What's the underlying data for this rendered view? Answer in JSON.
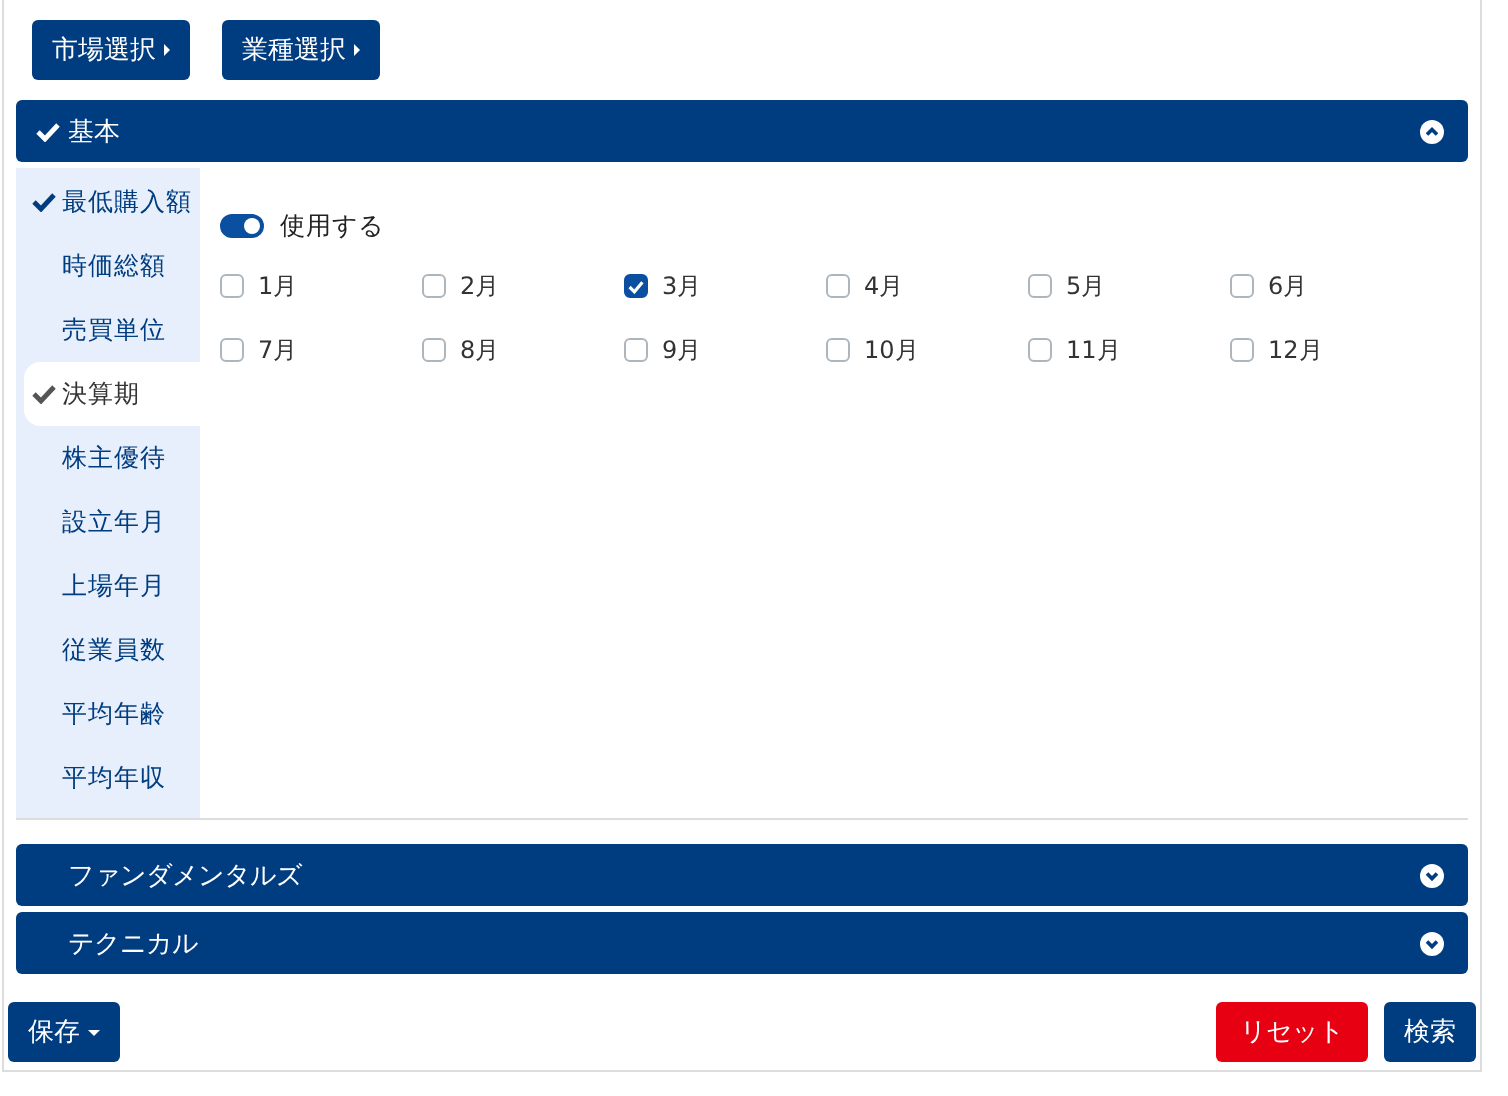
{
  "top_buttons": [
    {
      "label": "市場選択"
    },
    {
      "label": "業種選択"
    }
  ],
  "sections": [
    {
      "title": "基本",
      "checked": true,
      "expanded": true,
      "sidebar": [
        {
          "label": "最低購入額",
          "checked": true,
          "selected": false
        },
        {
          "label": "時価総額",
          "checked": false,
          "selected": false
        },
        {
          "label": "売買単位",
          "checked": false,
          "selected": false
        },
        {
          "label": "決算期",
          "checked": true,
          "selected": true
        },
        {
          "label": "株主優待",
          "checked": false,
          "selected": false
        },
        {
          "label": "設立年月",
          "checked": false,
          "selected": false
        },
        {
          "label": "上場年月",
          "checked": false,
          "selected": false
        },
        {
          "label": "従業員数",
          "checked": false,
          "selected": false
        },
        {
          "label": "平均年齢",
          "checked": false,
          "selected": false
        },
        {
          "label": "平均年収",
          "checked": false,
          "selected": false
        }
      ],
      "toggle": {
        "label": "使用する",
        "on": true
      },
      "months": [
        {
          "label": "1月",
          "checked": false
        },
        {
          "label": "2月",
          "checked": false
        },
        {
          "label": "3月",
          "checked": true
        },
        {
          "label": "4月",
          "checked": false
        },
        {
          "label": "5月",
          "checked": false
        },
        {
          "label": "6月",
          "checked": false
        },
        {
          "label": "7月",
          "checked": false
        },
        {
          "label": "8月",
          "checked": false
        },
        {
          "label": "9月",
          "checked": false
        },
        {
          "label": "10月",
          "checked": false
        },
        {
          "label": "11月",
          "checked": false
        },
        {
          "label": "12月",
          "checked": false
        }
      ]
    },
    {
      "title": "ファンダメンタルズ",
      "checked": false,
      "expanded": false
    },
    {
      "title": "テクニカル",
      "checked": false,
      "expanded": false
    }
  ],
  "footer": {
    "save": "保存",
    "reset": "リセット",
    "search": "検索"
  }
}
